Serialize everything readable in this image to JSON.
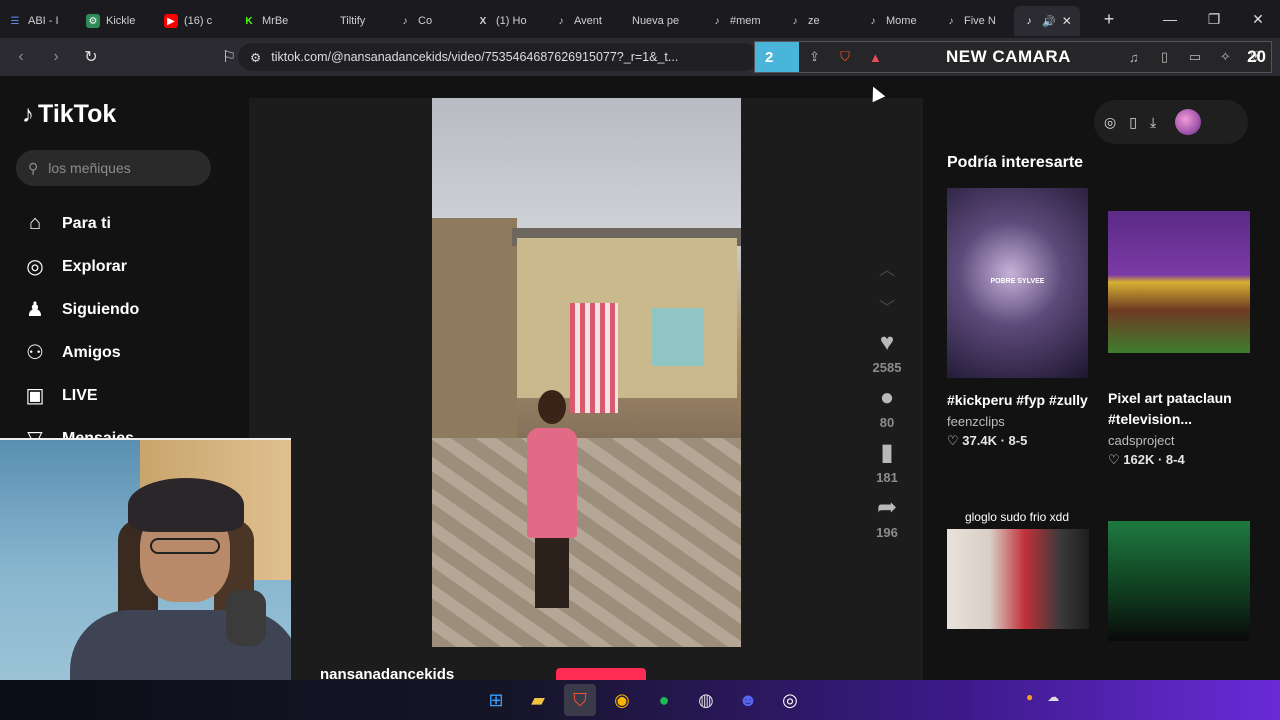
{
  "browser": {
    "tabs": [
      {
        "label": "ABI - I",
        "icon": "list-icon",
        "color": "#5b8def"
      },
      {
        "label": "Kickle",
        "icon": "tiktok-like-icon",
        "color": "#2e8b57"
      },
      {
        "label": "(16) c",
        "icon": "youtube-icon",
        "color": "#ff0000"
      },
      {
        "label": "MrBe",
        "icon": "kick-icon",
        "color": "#53fc18"
      },
      {
        "label": "Tiltify",
        "icon": "tiltify-icon",
        "color": "#444444"
      },
      {
        "label": "Co",
        "icon": "tiktok-icon",
        "color": "#ffffff"
      },
      {
        "label": "(1) Ho",
        "icon": "x-icon",
        "color": "#ffffff"
      },
      {
        "label": "Avent",
        "icon": "tiktok-icon",
        "color": "#ffffff"
      },
      {
        "label": "Nueva pe",
        "icon": "blank-icon",
        "color": "#444444"
      },
      {
        "label": "#mem",
        "icon": "tiktok-icon",
        "color": "#ffffff"
      },
      {
        "label": "ze",
        "icon": "tiktok-icon",
        "color": "#ffffff"
      },
      {
        "label": "Mome",
        "icon": "tiktok-icon",
        "color": "#ffffff"
      },
      {
        "label": "Five N",
        "icon": "tiktok-icon",
        "color": "#ffffff"
      }
    ],
    "new_tab": "+",
    "url": "tiktok.com/@nansanadancekids/video/7535464687626915077?_r=1&_t...",
    "extension_count": "2",
    "overlay_title": "NEW CAMARA",
    "overlay_number": "20"
  },
  "tiktok": {
    "logo": "TikTok",
    "search_placeholder": "los meñiques",
    "nav": [
      {
        "label": "Para ti",
        "icon": "home-icon",
        "glyph": "⌂"
      },
      {
        "label": "Explorar",
        "icon": "compass-icon",
        "glyph": "◎"
      },
      {
        "label": "Siguiendo",
        "icon": "following-icon",
        "glyph": "♟"
      },
      {
        "label": "Amigos",
        "icon": "friends-icon",
        "glyph": "⚇"
      },
      {
        "label": "LIVE",
        "icon": "live-icon",
        "glyph": "▣"
      },
      {
        "label": "Mensajes",
        "icon": "messages-icon",
        "glyph": "▽"
      }
    ],
    "actions": {
      "likes": "2585",
      "comments": "80",
      "saves": "181",
      "shares": "196"
    },
    "author": "nansanadancekids",
    "recommendations_title": "Podría interesarte",
    "cards": [
      {
        "title": "#kickperu #fyp #zully",
        "user": "feenzclips",
        "stats": "♡ 37.4K · 8-5",
        "thumb_text": "POBRE SYLVEE"
      },
      {
        "title": "Pixel art pataclaun #television...",
        "user": "cadsproject",
        "stats": "♡ 162K · 8-4"
      },
      {
        "caption": "gloglo sudo frio xdd"
      }
    ]
  }
}
